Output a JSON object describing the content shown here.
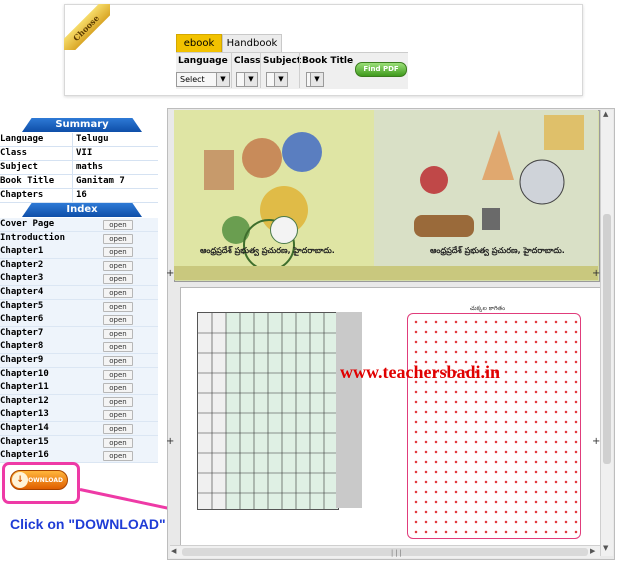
{
  "chooser": {
    "ribbon_label": "Choose",
    "tabs": [
      {
        "label": "ebook",
        "active": true
      },
      {
        "label": "Handbook",
        "active": false
      }
    ],
    "filters": [
      {
        "label": "Language",
        "selected": "Select"
      },
      {
        "label": "Class",
        "selected": ""
      },
      {
        "label": "Subject",
        "selected": ""
      },
      {
        "label": "Book Title",
        "selected": ""
      }
    ],
    "find_button": "Find PDF"
  },
  "summary": {
    "title": "Summary",
    "rows": [
      {
        "key": "Language",
        "value": "Telugu"
      },
      {
        "key": "Class",
        "value": "VII"
      },
      {
        "key": "Subject",
        "value": "maths"
      },
      {
        "key": "Book Title",
        "value": "Ganitam 7"
      },
      {
        "key": "Chapters",
        "value": "16"
      }
    ]
  },
  "index": {
    "title": "Index",
    "open_label": "open",
    "items": [
      "Cover Page",
      "Introduction",
      "Chapter1",
      "Chapter2",
      "Chapter3",
      "Chapter4",
      "Chapter5",
      "Chapter6",
      "Chapter7",
      "Chapter8",
      "Chapter9",
      "Chapter10",
      "Chapter11",
      "Chapter12",
      "Chapter13",
      "Chapter14",
      "Chapter15",
      "Chapter16"
    ]
  },
  "download": {
    "label": "DOWNLOAD"
  },
  "annotation": {
    "text": "Click on \"DOWNLOAD\" button",
    "color": "#1f3cd6",
    "arrow_color": "#ee3aa6"
  },
  "viewer": {
    "watermark": "www.teachersbadi.in",
    "caption_left": "ఆంధ్రప్రదేశ్ ప్రభుత్వ ప్రచురణ, హైదరాబాదు.",
    "caption_right": "ఆంధ్రప్రదేశ్ ప్రభుత్వ ప్రచురణ, హైదరాబాదు.",
    "dot_page_title": "చుక్కల కాగితం"
  },
  "colors": {
    "tab_active": "#f2c200",
    "header_blue": "#0e4ea8",
    "download_orange": "#e05f00",
    "highlight_pink": "#ee3aa6"
  }
}
